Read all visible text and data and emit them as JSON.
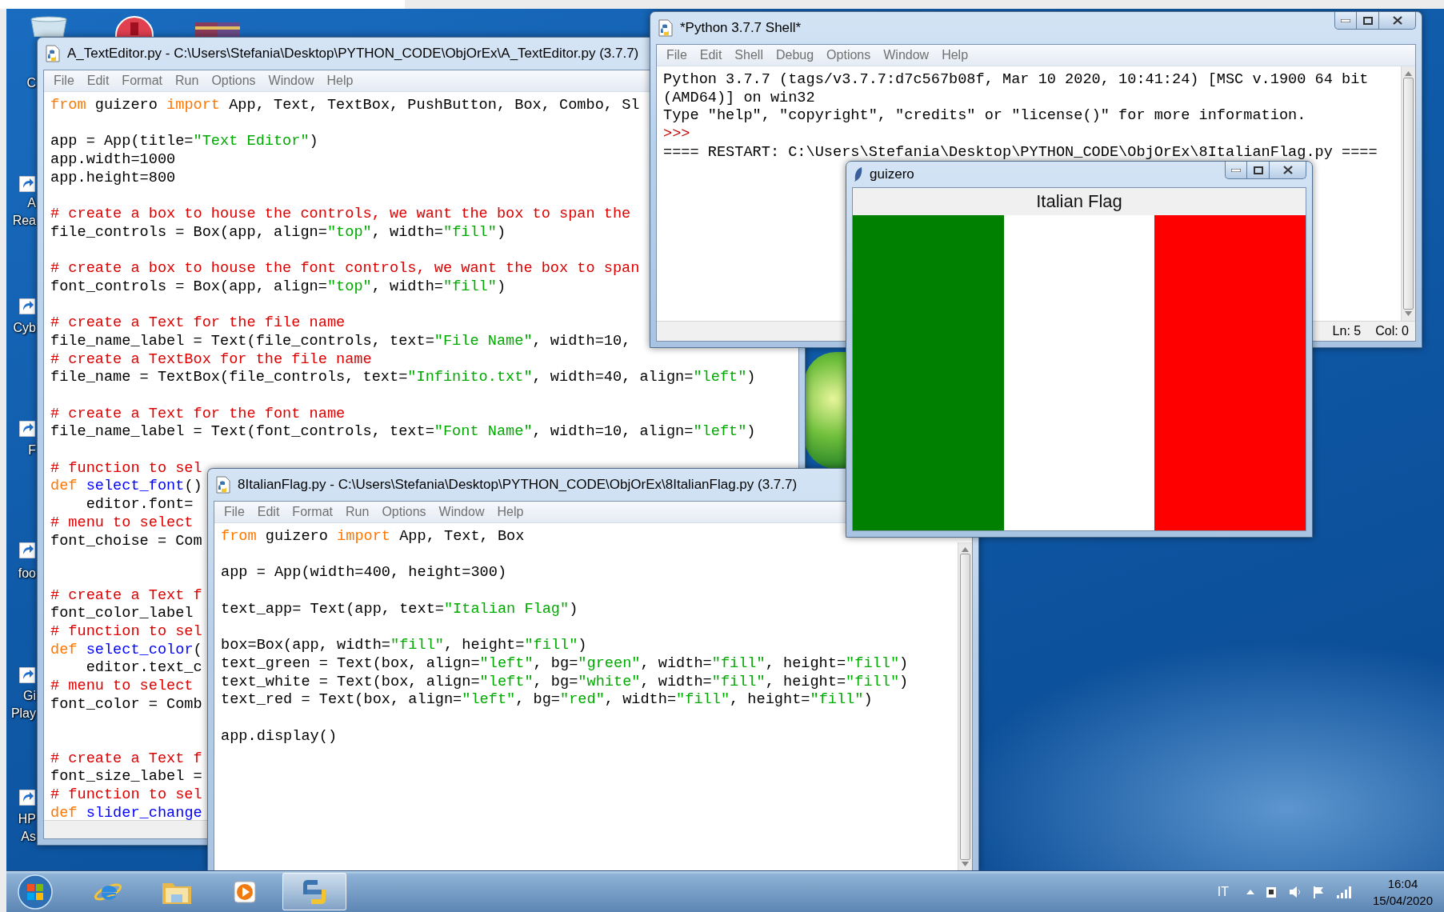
{
  "desktop_icons": [
    {
      "label": [
        "C"
      ]
    },
    {
      "label": [
        "A",
        "Rea"
      ]
    },
    {
      "label": [
        "Cyb"
      ]
    },
    {
      "label": [
        "F"
      ]
    },
    {
      "label": [
        "foo"
      ]
    },
    {
      "label": [
        "Gi",
        "Play"
      ]
    },
    {
      "label": [
        "HP",
        "As"
      ]
    }
  ],
  "text_editor": {
    "title": "A_TextEditor.py - C:\\Users\\Stefania\\Desktop\\PYTHON_CODE\\ObjOrEx\\A_TextEditor.py (3.7.7)",
    "menu": [
      "File",
      "Edit",
      "Format",
      "Run",
      "Options",
      "Window",
      "Help"
    ],
    "lines": [
      {
        "kind": "code",
        "tokens": [
          {
            "kind": "keyword",
            "text": "from"
          },
          {
            "kind": "plain",
            "text": " guizero "
          },
          {
            "kind": "keyword",
            "text": "import"
          },
          {
            "kind": "plain",
            "text": " App, Text, TextBox, PushButton, Box, Combo, Sl"
          }
        ]
      },
      {
        "kind": "blank"
      },
      {
        "kind": "code",
        "tokens": [
          {
            "kind": "plain",
            "text": "app = App(title="
          },
          {
            "kind": "string",
            "text": "\"Text Editor\""
          },
          {
            "kind": "plain",
            "text": ")"
          }
        ]
      },
      {
        "kind": "code",
        "tokens": [
          {
            "kind": "plain",
            "text": "app.width=1000"
          }
        ]
      },
      {
        "kind": "code",
        "tokens": [
          {
            "kind": "plain",
            "text": "app.height=800"
          }
        ]
      },
      {
        "kind": "blank"
      },
      {
        "kind": "code",
        "tokens": [
          {
            "kind": "comment",
            "text": "# create a box to house the controls, we want the box to span the"
          }
        ]
      },
      {
        "kind": "code",
        "tokens": [
          {
            "kind": "plain",
            "text": "file_controls = Box(app, align="
          },
          {
            "kind": "string",
            "text": "\"top\""
          },
          {
            "kind": "plain",
            "text": ", width="
          },
          {
            "kind": "string",
            "text": "\"fill\""
          },
          {
            "kind": "plain",
            "text": ")"
          }
        ]
      },
      {
        "kind": "blank"
      },
      {
        "kind": "code",
        "tokens": [
          {
            "kind": "comment",
            "text": "# create a box to house the font controls, we want the box to span"
          }
        ]
      },
      {
        "kind": "code",
        "tokens": [
          {
            "kind": "plain",
            "text": "font_controls = Box(app, align="
          },
          {
            "kind": "string",
            "text": "\"top\""
          },
          {
            "kind": "plain",
            "text": ", width="
          },
          {
            "kind": "string",
            "text": "\"fill\""
          },
          {
            "kind": "plain",
            "text": ")"
          }
        ]
      },
      {
        "kind": "blank"
      },
      {
        "kind": "code",
        "tokens": [
          {
            "kind": "comment",
            "text": "# create a Text for the file name"
          }
        ]
      },
      {
        "kind": "code",
        "tokens": [
          {
            "kind": "plain",
            "text": "file_name_label = Text(file_controls, text="
          },
          {
            "kind": "string",
            "text": "\"File Name\""
          },
          {
            "kind": "plain",
            "text": ", width=10,"
          }
        ]
      },
      {
        "kind": "code",
        "tokens": [
          {
            "kind": "comment",
            "text": "# create a TextBox for the file name"
          }
        ]
      },
      {
        "kind": "code",
        "tokens": [
          {
            "kind": "plain",
            "text": "file_name = TextBox(file_controls, text="
          },
          {
            "kind": "string",
            "text": "\"Infinito.txt\""
          },
          {
            "kind": "plain",
            "text": ", width=40, align="
          },
          {
            "kind": "string",
            "text": "\"left\""
          },
          {
            "kind": "plain",
            "text": ")"
          }
        ]
      },
      {
        "kind": "blank"
      },
      {
        "kind": "code",
        "tokens": [
          {
            "kind": "comment",
            "text": "# create a Text for the font name"
          }
        ]
      },
      {
        "kind": "code",
        "tokens": [
          {
            "kind": "plain",
            "text": "file_name_label = Text(font_controls, text="
          },
          {
            "kind": "string",
            "text": "\"Font Name\""
          },
          {
            "kind": "plain",
            "text": ", width=10, align="
          },
          {
            "kind": "string",
            "text": "\"left\""
          },
          {
            "kind": "plain",
            "text": ")"
          }
        ]
      },
      {
        "kind": "blank"
      },
      {
        "kind": "code",
        "tokens": [
          {
            "kind": "comment",
            "text": "# function to sel"
          }
        ]
      },
      {
        "kind": "code",
        "tokens": [
          {
            "kind": "keyword",
            "text": "def "
          },
          {
            "kind": "defname",
            "text": "select_font"
          },
          {
            "kind": "plain",
            "text": "()"
          }
        ]
      },
      {
        "kind": "code",
        "tokens": [
          {
            "kind": "plain",
            "text": "    editor.font="
          }
        ]
      },
      {
        "kind": "code",
        "tokens": [
          {
            "kind": "comment",
            "text": "# menu to select"
          }
        ]
      },
      {
        "kind": "code",
        "tokens": [
          {
            "kind": "plain",
            "text": "font_choise = Com"
          }
        ]
      },
      {
        "kind": "blank"
      },
      {
        "kind": "blank"
      },
      {
        "kind": "code",
        "tokens": [
          {
            "kind": "comment",
            "text": "# create a Text f"
          }
        ]
      },
      {
        "kind": "code",
        "tokens": [
          {
            "kind": "plain",
            "text": "font_color_label"
          }
        ]
      },
      {
        "kind": "code",
        "tokens": [
          {
            "kind": "comment",
            "text": "# function to sel"
          }
        ]
      },
      {
        "kind": "code",
        "tokens": [
          {
            "kind": "keyword",
            "text": "def "
          },
          {
            "kind": "defname",
            "text": "select_color"
          },
          {
            "kind": "plain",
            "text": "("
          }
        ]
      },
      {
        "kind": "code",
        "tokens": [
          {
            "kind": "plain",
            "text": "    editor.text_c"
          }
        ]
      },
      {
        "kind": "code",
        "tokens": [
          {
            "kind": "comment",
            "text": "# menu to select"
          }
        ]
      },
      {
        "kind": "code",
        "tokens": [
          {
            "kind": "plain",
            "text": "font_color = Comb"
          }
        ]
      },
      {
        "kind": "blank"
      },
      {
        "kind": "blank"
      },
      {
        "kind": "code",
        "tokens": [
          {
            "kind": "comment",
            "text": "# create a Text f"
          }
        ]
      },
      {
        "kind": "code",
        "tokens": [
          {
            "kind": "plain",
            "text": "font_size_label ="
          }
        ]
      },
      {
        "kind": "code",
        "tokens": [
          {
            "kind": "comment",
            "text": "# function to sel"
          }
        ]
      },
      {
        "kind": "code",
        "tokens": [
          {
            "kind": "keyword",
            "text": "def "
          },
          {
            "kind": "defname",
            "text": "slider_change"
          }
        ]
      }
    ]
  },
  "shell": {
    "title": "*Python 3.7.7 Shell*",
    "menu": [
      "File",
      "Edit",
      "Shell",
      "Debug",
      "Options",
      "Window",
      "Help"
    ],
    "lines": [
      {
        "kind": "code",
        "tokens": [
          {
            "kind": "plain",
            "text": "Python 3.7.7 (tags/v3.7.7:d7c567b08f, Mar 10 2020, 10:41:24) [MSC v.1900 64 bit"
          }
        ]
      },
      {
        "kind": "code",
        "tokens": [
          {
            "kind": "plain",
            "text": "(AMD64)] on win32"
          }
        ]
      },
      {
        "kind": "code",
        "tokens": [
          {
            "kind": "plain",
            "text": "Type \"help\", \"copyright\", \"credits\" or \"license()\" for more information."
          }
        ]
      },
      {
        "kind": "code",
        "tokens": [
          {
            "kind": "prompt",
            "text": ">>>"
          }
        ]
      },
      {
        "kind": "code",
        "tokens": [
          {
            "kind": "plain",
            "text": "==== RESTART: C:\\Users\\Stefania\\Desktop\\PYTHON_CODE\\ObjOrEx\\8ItalianFlag.py ===="
          }
        ]
      }
    ],
    "status": {
      "line": "Ln: 5",
      "column": "Col: 0"
    }
  },
  "flag_editor": {
    "title": "8ItalianFlag.py - C:\\Users\\Stefania\\Desktop\\PYTHON_CODE\\ObjOrEx\\8ItalianFlag.py (3.7.7)",
    "menu": [
      "File",
      "Edit",
      "Format",
      "Run",
      "Options",
      "Window",
      "Help"
    ],
    "lines": [
      {
        "kind": "code",
        "tokens": [
          {
            "kind": "keyword",
            "text": "from"
          },
          {
            "kind": "plain",
            "text": " guizero "
          },
          {
            "kind": "keyword",
            "text": "import"
          },
          {
            "kind": "plain",
            "text": " App, Text, Box"
          }
        ]
      },
      {
        "kind": "blank"
      },
      {
        "kind": "code",
        "tokens": [
          {
            "kind": "plain",
            "text": "app = App(width=400, height=300)"
          }
        ]
      },
      {
        "kind": "blank"
      },
      {
        "kind": "code",
        "tokens": [
          {
            "kind": "plain",
            "text": "text_app= Text(app, text="
          },
          {
            "kind": "string",
            "text": "\"Italian Flag\""
          },
          {
            "kind": "plain",
            "text": ")"
          }
        ]
      },
      {
        "kind": "blank"
      },
      {
        "kind": "code",
        "tokens": [
          {
            "kind": "plain",
            "text": "box=Box(app, width="
          },
          {
            "kind": "string",
            "text": "\"fill\""
          },
          {
            "kind": "plain",
            "text": ", height="
          },
          {
            "kind": "string",
            "text": "\"fill\""
          },
          {
            "kind": "plain",
            "text": ")"
          }
        ]
      },
      {
        "kind": "code",
        "tokens": [
          {
            "kind": "plain",
            "text": "text_green = Text(box, align="
          },
          {
            "kind": "string",
            "text": "\"left\""
          },
          {
            "kind": "plain",
            "text": ", bg="
          },
          {
            "kind": "string",
            "text": "\"green\""
          },
          {
            "kind": "plain",
            "text": ", width="
          },
          {
            "kind": "string",
            "text": "\"fill\""
          },
          {
            "kind": "plain",
            "text": ", height="
          },
          {
            "kind": "string",
            "text": "\"fill\""
          },
          {
            "kind": "plain",
            "text": ")"
          }
        ]
      },
      {
        "kind": "code",
        "tokens": [
          {
            "kind": "plain",
            "text": "text_white = Text(box, align="
          },
          {
            "kind": "string",
            "text": "\"left\""
          },
          {
            "kind": "plain",
            "text": ", bg="
          },
          {
            "kind": "string",
            "text": "\"white\""
          },
          {
            "kind": "plain",
            "text": ", width="
          },
          {
            "kind": "string",
            "text": "\"fill\""
          },
          {
            "kind": "plain",
            "text": ", height="
          },
          {
            "kind": "string",
            "text": "\"fill\""
          },
          {
            "kind": "plain",
            "text": ")"
          }
        ]
      },
      {
        "kind": "code",
        "tokens": [
          {
            "kind": "plain",
            "text": "text_red = Text(box, align="
          },
          {
            "kind": "string",
            "text": "\"left\""
          },
          {
            "kind": "plain",
            "text": ", bg="
          },
          {
            "kind": "string",
            "text": "\"red\""
          },
          {
            "kind": "plain",
            "text": ", width="
          },
          {
            "kind": "string",
            "text": "\"fill\""
          },
          {
            "kind": "plain",
            "text": ", height="
          },
          {
            "kind": "string",
            "text": "\"fill\""
          },
          {
            "kind": "plain",
            "text": ")"
          }
        ]
      },
      {
        "kind": "blank"
      },
      {
        "kind": "code",
        "tokens": [
          {
            "kind": "plain",
            "text": "app.display()"
          }
        ]
      }
    ]
  },
  "guizero_app": {
    "title": "guizero",
    "heading": "Italian Flag",
    "stripes": [
      {
        "color": "#008000"
      },
      {
        "color": "#ffffff"
      },
      {
        "color": "#ff0000"
      }
    ]
  },
  "taskbar": {
    "apps": [
      {
        "kind": "browser",
        "active": false
      },
      {
        "kind": "folder",
        "active": false
      },
      {
        "kind": "media",
        "active": false
      },
      {
        "kind": "python",
        "active": true
      }
    ],
    "language": "IT",
    "time": "16:04",
    "date": "15/04/2020"
  }
}
